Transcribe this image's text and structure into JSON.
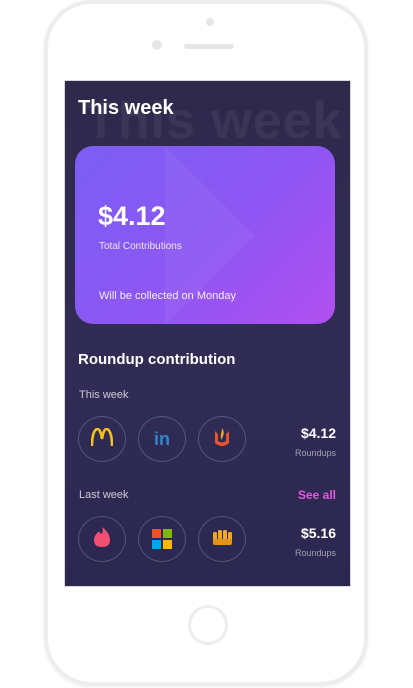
{
  "screen": {
    "background_heading": "This week",
    "title": "This week"
  },
  "card": {
    "amount": "$4.12",
    "subtitle": "Total Contributions",
    "note": "Will be collected on Monday"
  },
  "section": {
    "title": "Roundup contribution"
  },
  "this_week": {
    "label": "This week",
    "merchants": [
      "mcdonalds-logo-icon",
      "linkedin-logo-icon",
      "flame-logo-icon"
    ],
    "amount": "$4.12",
    "amount_label": "Roundups",
    "linkedin_text": "in"
  },
  "last_week": {
    "label": "Last week",
    "see_all": "See all",
    "merchants": [
      "tinder-logo-icon",
      "microsoft-logo-icon",
      "fist-logo-icon"
    ],
    "amount": "$5.16",
    "amount_label": "Roundups"
  },
  "colors": {
    "accent": "#e05bd9",
    "card_start": "#7b5ef4",
    "card_end": "#b24ff0",
    "background": "#2f2a4c"
  }
}
